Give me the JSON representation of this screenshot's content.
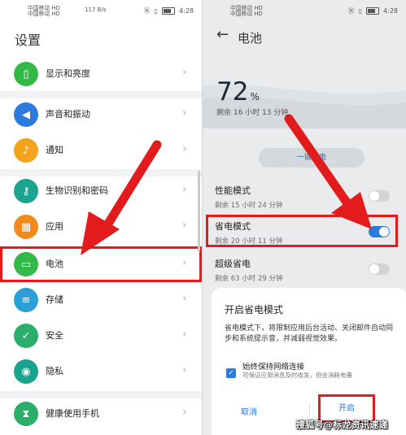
{
  "left_status": {
    "carrier": "中国移动 HD\n中国移动 HD",
    "speed": "117 B/s",
    "time": "4:28"
  },
  "settings": {
    "title": "设置",
    "items": [
      {
        "label": "显示和亮度",
        "icon": "display-icon",
        "color": "#35b84a"
      },
      {
        "label": "声音和振动",
        "icon": "sound-icon",
        "color": "#2a7bdc"
      },
      {
        "label": "通知",
        "icon": "bell-icon",
        "color": "#f4a41c"
      },
      {
        "label": "生物识别和密码",
        "icon": "key-icon",
        "color": "#1aa38f"
      },
      {
        "label": "应用",
        "icon": "apps-icon",
        "color": "#f08a1c"
      },
      {
        "label": "电池",
        "icon": "battery-icon",
        "color": "#35b84a"
      },
      {
        "label": "存储",
        "icon": "storage-icon",
        "color": "#2aa0d6"
      },
      {
        "label": "安全",
        "icon": "shield-icon",
        "color": "#2bae6a"
      },
      {
        "label": "隐私",
        "icon": "privacy-icon",
        "color": "#1aa38f"
      },
      {
        "label": "健康使用手机",
        "icon": "hourglass-icon",
        "color": "#2bae6a"
      }
    ]
  },
  "right_status": {
    "carrier": "中国移动 HD\n中国移动 HD",
    "time": "4:28"
  },
  "battery": {
    "title": "电池",
    "percent": "72",
    "percent_unit": "%",
    "remaining": "剩余 16 小时 13 分钟",
    "one_tap_button": "一键省电",
    "modes": [
      {
        "title": "性能模式",
        "sub": "剩余 15 小时 24 分钟",
        "on": false
      },
      {
        "title": "省电模式",
        "sub": "剩余 20 小时 11 分钟",
        "on": true
      },
      {
        "title": "超级省电",
        "sub": "剩余 63 小时 29 分钟",
        "on": false
      }
    ]
  },
  "dialog": {
    "title": "开启省电模式",
    "description": "省电模式下，将限制应用后台活动、关闭邮件自动同步和系统提示音，并减弱视觉效果。",
    "checkbox_label": "始终保持网络连接",
    "checkbox_sub": "可保证应用消息及时收发，但会消耗电量",
    "cancel": "取消",
    "confirm": "开启",
    "watermark": "搜狐号@标龙资讯速递"
  },
  "colors": {
    "annotation_red": "#e21c1c",
    "accent_blue": "#2a7bdc"
  }
}
